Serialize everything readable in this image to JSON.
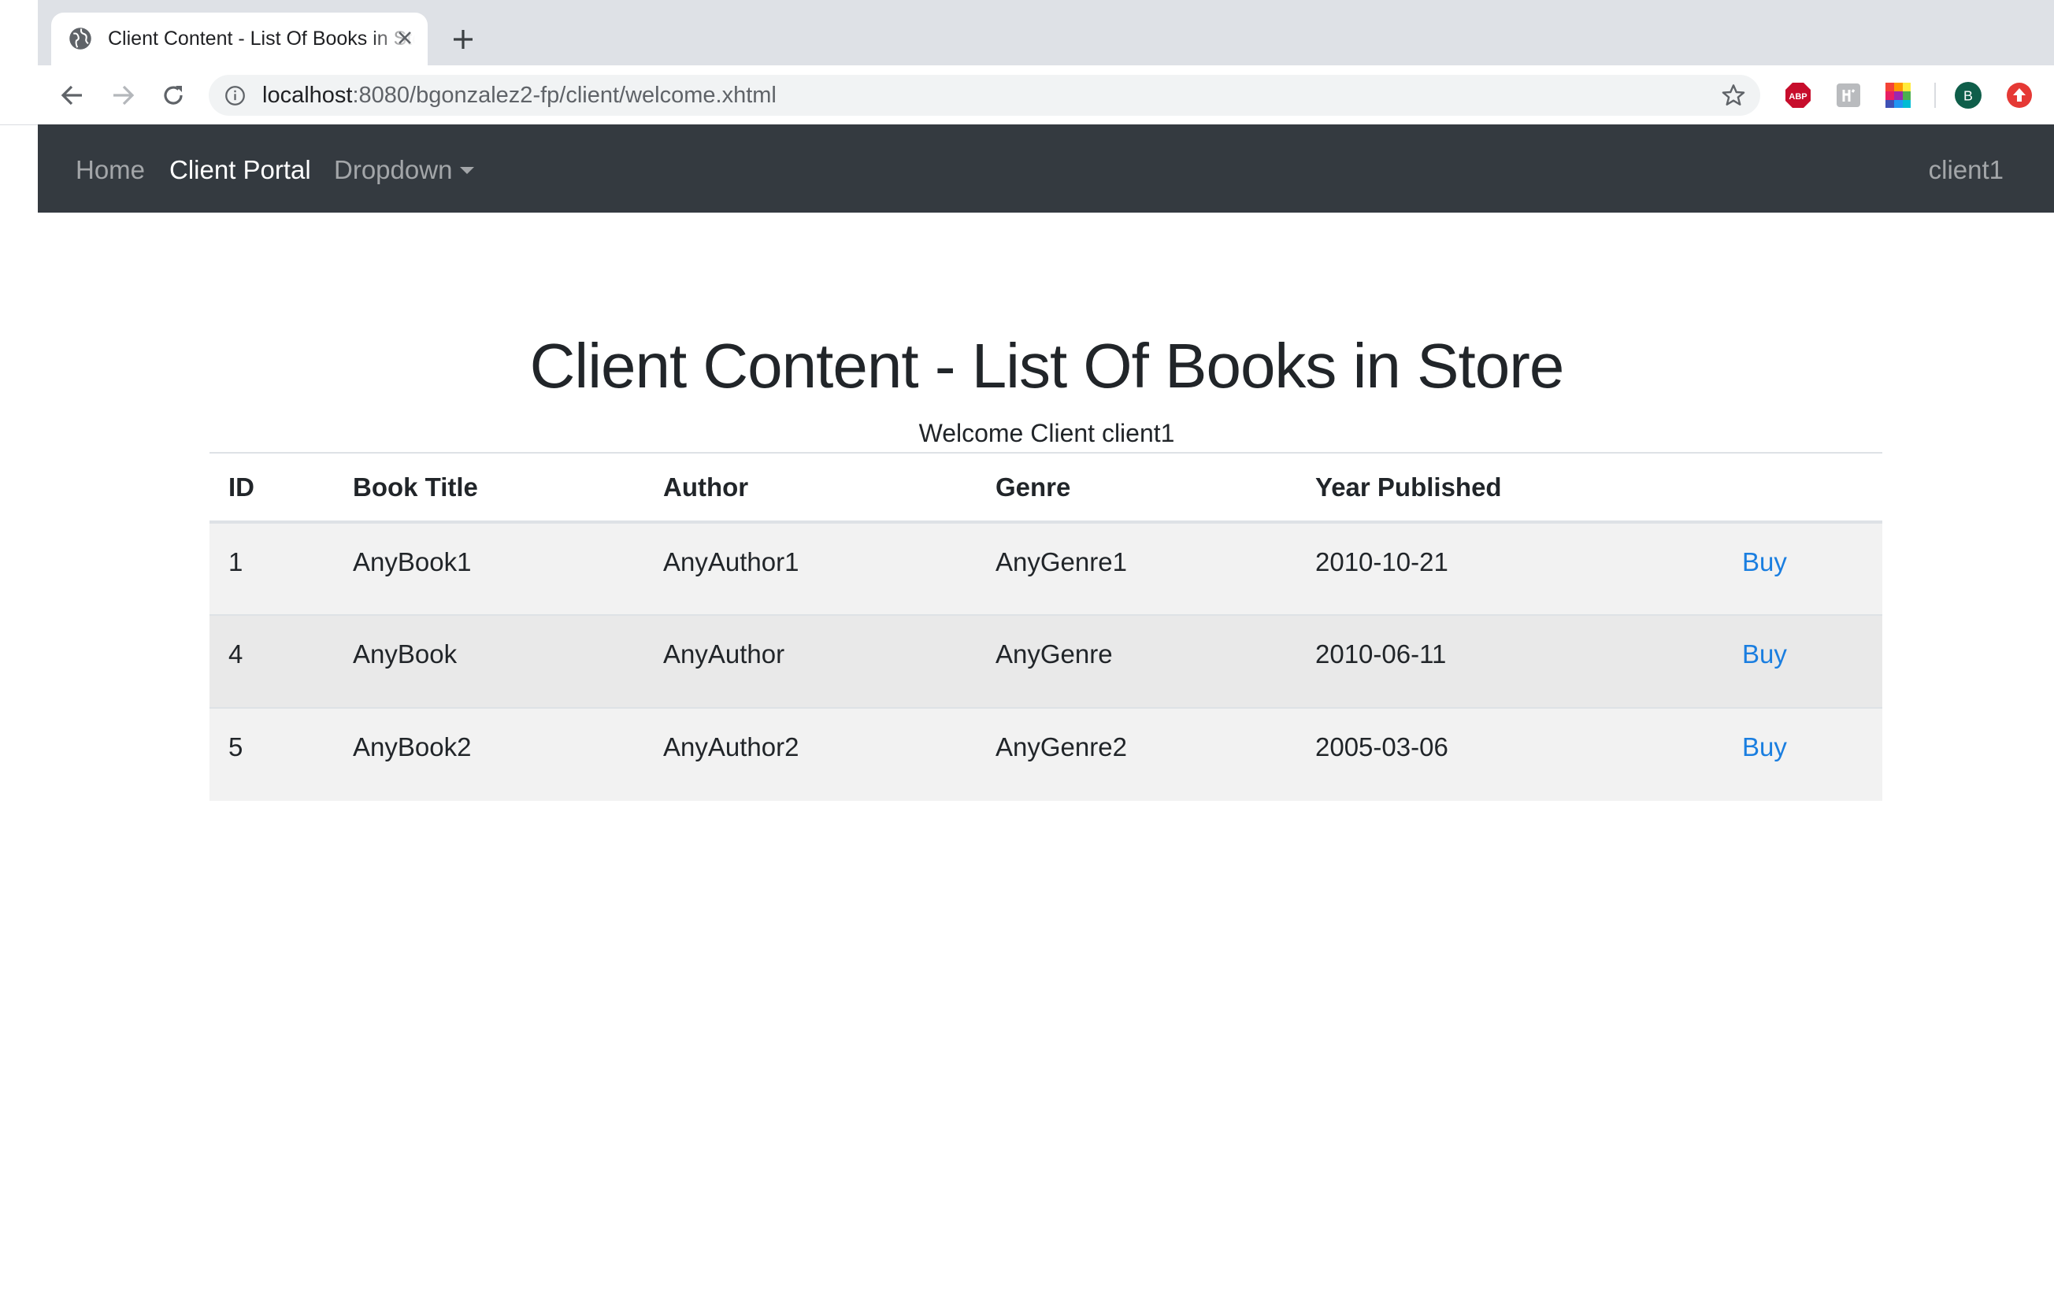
{
  "browser": {
    "tab_title": "Client Content - List Of Books in Store",
    "url_host": "localhost",
    "url_path": ":8080/bgonzalez2-fp/client/welcome.xhtml",
    "extensions": [
      "adblock-plus-icon",
      "extension-icon",
      "color-picker-icon",
      "profile-avatar",
      "upload-icon"
    ],
    "profile_initial": "B"
  },
  "navbar": {
    "home": "Home",
    "client_portal": "Client Portal",
    "dropdown": "Dropdown",
    "user": "client1"
  },
  "main": {
    "title": "Client Content - List Of Books in Store",
    "welcome": "Welcome Client client1",
    "table": {
      "headers": [
        "ID",
        "Book Title",
        "Author",
        "Genre",
        "Year Published",
        ""
      ],
      "rows": [
        {
          "id": "1",
          "title": "AnyBook1",
          "author": "AnyAuthor1",
          "genre": "AnyGenre1",
          "year": "2010-10-21",
          "action": "Buy"
        },
        {
          "id": "4",
          "title": "AnyBook",
          "author": "AnyAuthor",
          "genre": "AnyGenre",
          "year": "2010-06-11",
          "action": "Buy"
        },
        {
          "id": "5",
          "title": "AnyBook2",
          "author": "AnyAuthor2",
          "genre": "AnyGenre2",
          "year": "2005-03-06",
          "action": "Buy"
        }
      ]
    }
  },
  "colors": {
    "navbar_bg": "#343a40",
    "link": "#1a7ee0",
    "row_odd": "#f2f2f2",
    "row_even": "#e9e9e9"
  }
}
